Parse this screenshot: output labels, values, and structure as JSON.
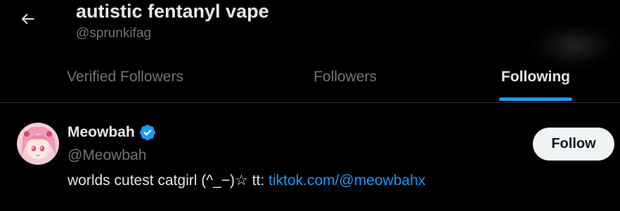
{
  "header": {
    "title": "autistic fentanyl vape",
    "handle": "@sprunkifag",
    "back_icon": "arrow-left-icon"
  },
  "tabs": [
    {
      "label": "Verified Followers",
      "active": false
    },
    {
      "label": "Followers",
      "active": false
    },
    {
      "label": "Following",
      "active": true
    }
  ],
  "user": {
    "name": "Meowbah",
    "handle": "@Meowbah",
    "verified_icon": "verified-badge-icon",
    "bio_text": "worlds cutest catgirl (^_−)☆ tt: ",
    "bio_link": "tiktok.com/@meowbahx",
    "follow_label": "Follow"
  },
  "colors": {
    "background": "#000000",
    "text_primary": "#e7e9ea",
    "text_secondary": "#71767b",
    "accent": "#1d9bf0",
    "button_bg": "#eff3f4"
  }
}
